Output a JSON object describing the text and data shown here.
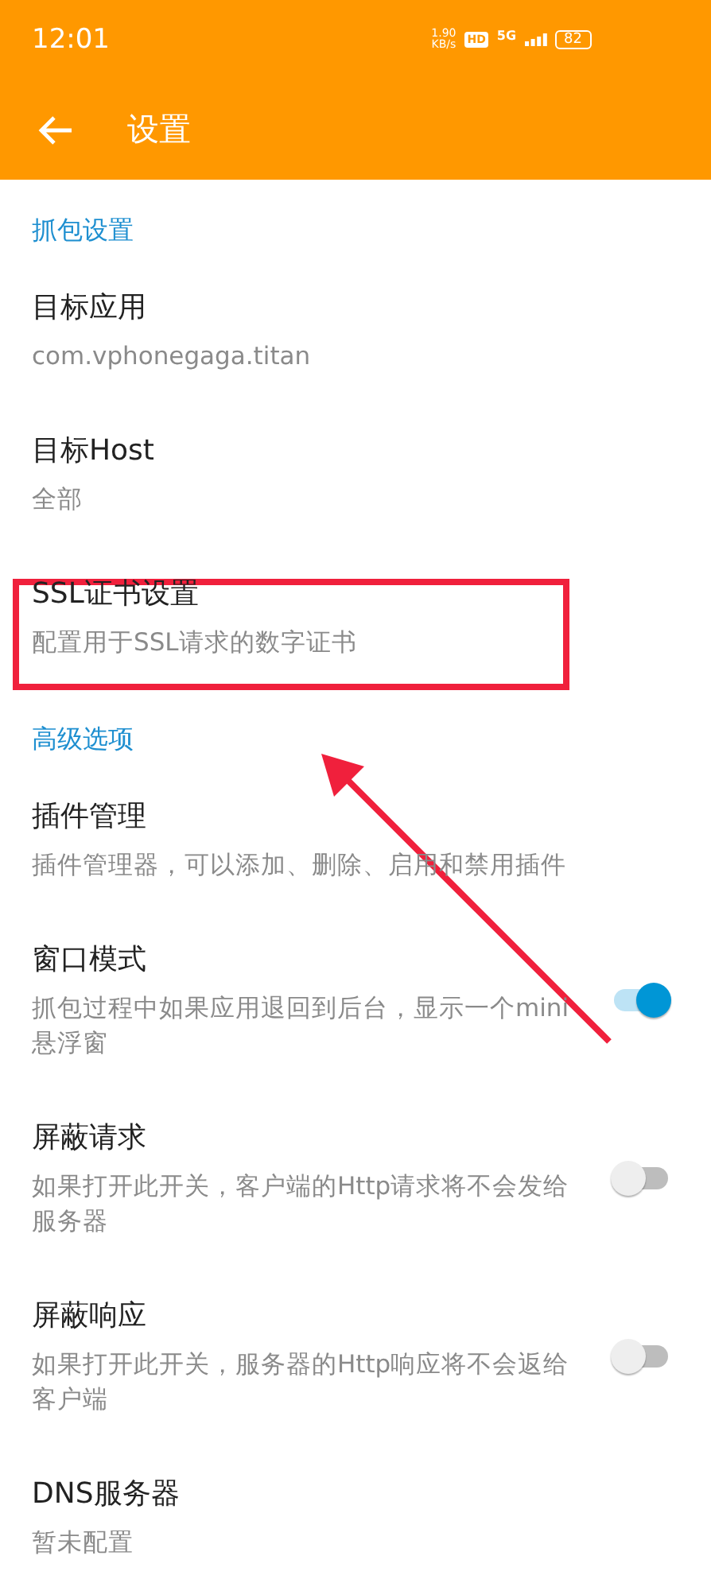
{
  "status_bar": {
    "time": "12:01",
    "speed": "1.90",
    "speed_unit": "KB/s",
    "hd": "HD",
    "network": "5G",
    "battery": "82"
  },
  "app_bar": {
    "title": "设置"
  },
  "sections": [
    {
      "header": "抓包设置",
      "items": [
        {
          "title": "目标应用",
          "subtitle": "com.vphonegaga.titan",
          "kind": "plain"
        },
        {
          "title": "目标Host",
          "subtitle": "全部",
          "kind": "plain"
        },
        {
          "title": "SSL证书设置",
          "subtitle": "配置用于SSL请求的数字证书",
          "kind": "plain",
          "highlighted": true
        }
      ]
    },
    {
      "header": "高级选项",
      "items": [
        {
          "title": "插件管理",
          "subtitle": "插件管理器，可以添加、删除、启用和禁用插件",
          "kind": "plain"
        },
        {
          "title": "窗口模式",
          "subtitle": "抓包过程中如果应用退回到后台，显示一个mini悬浮窗",
          "kind": "switch",
          "on": true
        },
        {
          "title": "屏蔽请求",
          "subtitle": "如果打开此开关，客户端的Http请求将不会发给服务器",
          "kind": "switch",
          "on": false
        },
        {
          "title": "屏蔽响应",
          "subtitle": "如果打开此开关，服务器的Http响应将不会返给客户端",
          "kind": "switch",
          "on": false
        },
        {
          "title": "DNS服务器",
          "subtitle": "暂未配置",
          "kind": "plain"
        }
      ]
    }
  ]
}
